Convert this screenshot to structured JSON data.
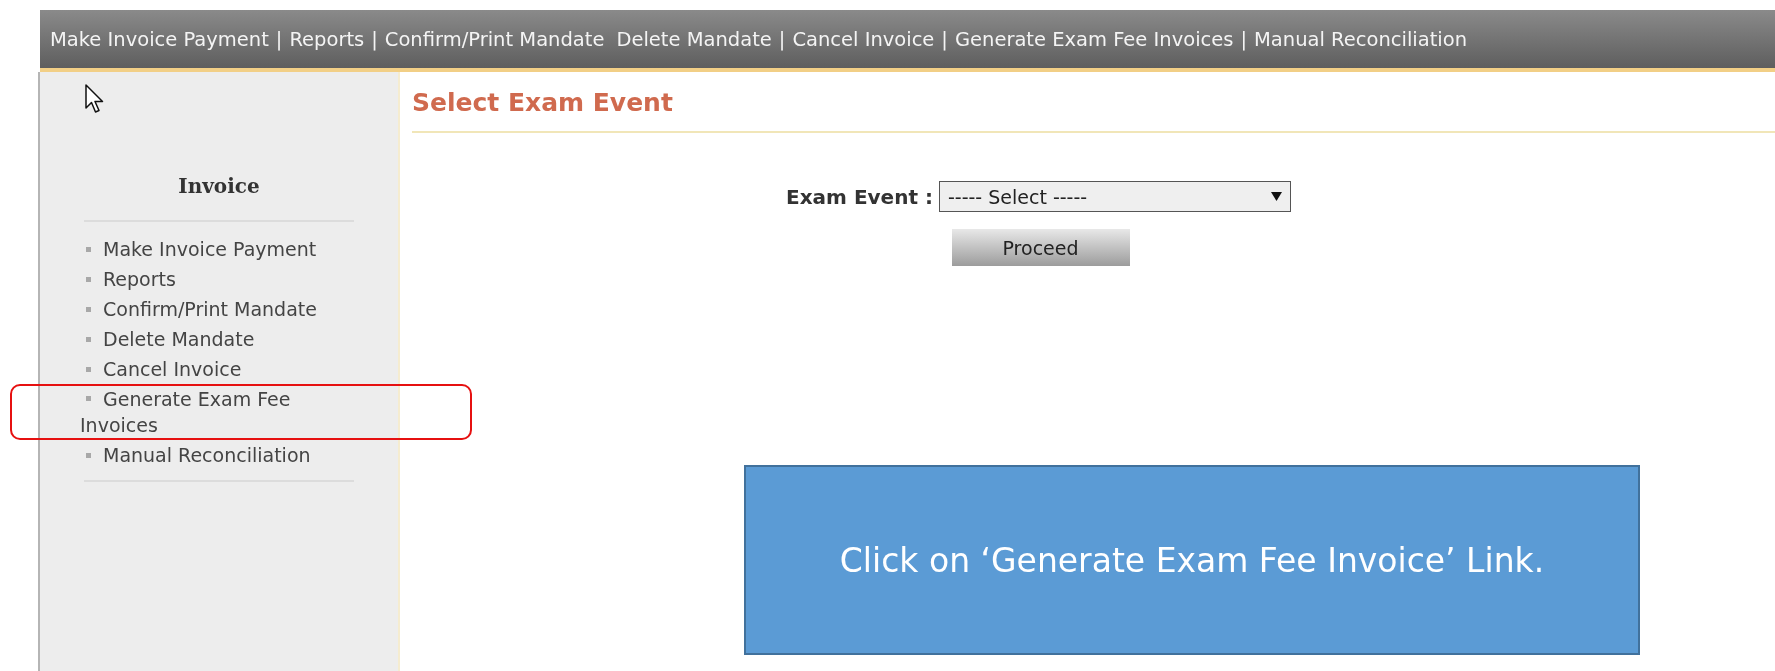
{
  "top_menu": [
    {
      "label": "Make Invoice Payment",
      "separator": "|"
    },
    {
      "label": "Reports",
      "separator": "|"
    },
    {
      "label": "Confirm/Print Mandate"
    },
    {
      "label": "Delete Mandate",
      "separator": "|"
    },
    {
      "label": "Cancel Invoice",
      "separator": "|"
    },
    {
      "label": "Generate Exam Fee Invoices",
      "separator": "|"
    },
    {
      "label": "Manual Reconciliation"
    }
  ],
  "sidebar": {
    "title": "Invoice",
    "items": [
      {
        "label": "Make Invoice Payment",
        "highlighted": false
      },
      {
        "label": "Reports",
        "highlighted": false
      },
      {
        "label": "Confirm/Print Mandate",
        "highlighted": false
      },
      {
        "label": "Delete Mandate",
        "highlighted": false
      },
      {
        "label": "Cancel Invoice",
        "highlighted": false
      },
      {
        "label": "Generate Exam Fee Invoices",
        "highlighted": true
      },
      {
        "label": "Manual Reconciliation",
        "highlighted": false
      }
    ]
  },
  "page_title": "Select Exam Event",
  "form": {
    "label": "Exam Event :",
    "select_value": "----- Select -----",
    "button": "Proceed"
  },
  "callout": {
    "text": "Click on ‘Generate Exam Fee Invoice’ Link."
  }
}
